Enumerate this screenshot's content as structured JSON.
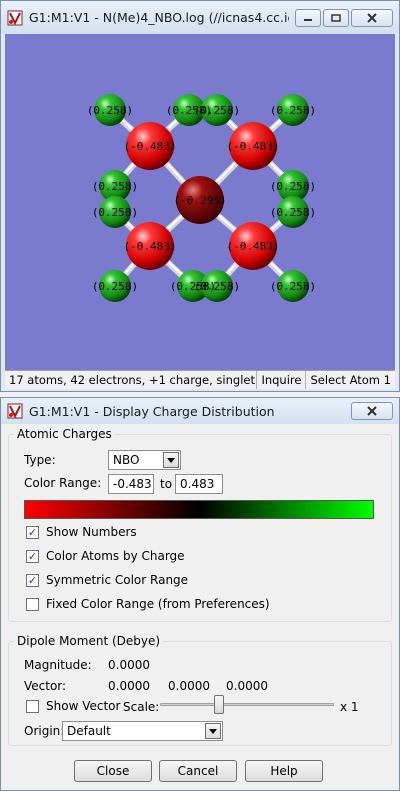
{
  "viewer": {
    "title": "G1:M1:V1 - N(Me)4_NBO.log (//icnas4.cc.ic.ac.uk...",
    "status": "17 atoms, 42 electrons, +1 charge, singlet",
    "inquire": "Inquire",
    "select_atom": "Select Atom 1",
    "background_color": "#7a7acf",
    "labels": {
      "nitrogen": "-0.295",
      "carbon": "-0.483",
      "hydrogen": "0.258"
    }
  },
  "dialog": {
    "title": "G1:M1:V1 - Display Charge Distribution",
    "atomic_charges": {
      "group_label": "Atomic Charges",
      "type_label": "Type:",
      "type_value": "NBO",
      "color_range_label": "Color Range:",
      "range_min": "-0.483",
      "to_label": "to",
      "range_max": "0.483",
      "gradient_colors": [
        "#ff0000",
        "#000000",
        "#00ff00"
      ],
      "checkboxes": [
        {
          "label": "Show Numbers",
          "checked": true
        },
        {
          "label": "Color Atoms by Charge",
          "checked": true
        },
        {
          "label": "Symmetric Color Range",
          "checked": true
        },
        {
          "label": "Fixed Color Range (from Preferences)",
          "checked": false
        }
      ]
    },
    "dipole": {
      "group_label": "Dipole Moment (Debye)",
      "magnitude_label": "Magnitude:",
      "magnitude_value": "0.0000",
      "vector_label": "Vector:",
      "vector_x": "0.0000",
      "vector_y": "0.0000",
      "vector_z": "0.0000",
      "show_vector_label": "Show Vector",
      "show_vector_checked": false,
      "scale_label": "Scale:",
      "scale_suffix": "x 1",
      "origin_label": "Origin:",
      "origin_value": "Default"
    },
    "buttons": {
      "close": "Close",
      "cancel": "Cancel",
      "help": "Help"
    }
  }
}
